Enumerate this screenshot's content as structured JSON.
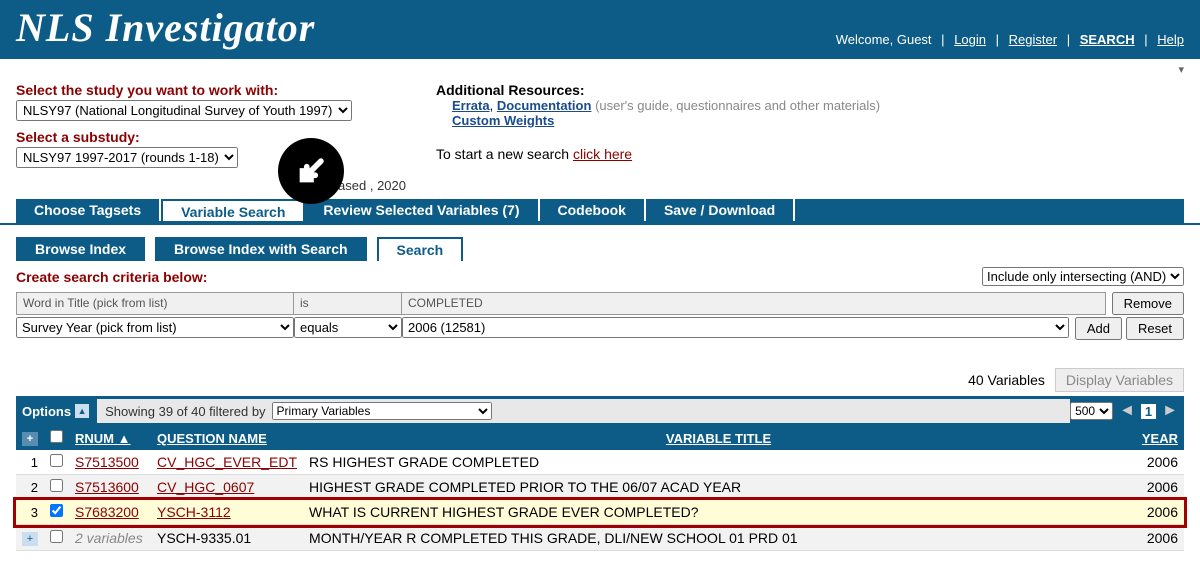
{
  "header": {
    "title": "NLS Investigator",
    "welcome": "Welcome, Guest",
    "links": {
      "login": "Login",
      "register": "Register",
      "search": "SEARCH",
      "help": "Help"
    }
  },
  "study": {
    "label": "Select the study you want to work with:",
    "value": "NLSY97 (National Longitudinal Survey of Youth 1997)",
    "substudy_label": "Select a substudy:",
    "substudy_value": "NLSY97 1997-2017 (rounds 1-18)",
    "released": "Released , 2020"
  },
  "resources": {
    "label": "Additional Resources:",
    "errata": "Errata",
    "documentation": "Documentation",
    "doc_hint": "(user's guide, questionnaires and other materials)",
    "custom_weights": "Custom Weights",
    "newsearch_prefix": "To start a new search ",
    "newsearch_link": "click here"
  },
  "tabs1": {
    "choose_tagsets": "Choose Tagsets",
    "variable_search": "Variable Search",
    "review": "Review Selected Variables (7)",
    "codebook": "Codebook",
    "save": "Save / Download"
  },
  "tabs2": {
    "browse_index": "Browse Index",
    "browse_search": "Browse Index with Search",
    "search": "Search"
  },
  "search": {
    "label": "Create search criteria below:",
    "mode": "Include only intersecting (AND)",
    "row1": {
      "field": "Word in Title   (pick from list)",
      "op": "is",
      "value": "COMPLETED",
      "btn": "Remove"
    },
    "row2": {
      "field": "Survey Year   (pick from list)",
      "op": "equals",
      "value": "2006 (12581)",
      "add": "Add",
      "reset": "Reset"
    }
  },
  "results": {
    "count": "40 Variables",
    "display_btn": "Display Variables",
    "options": "Options",
    "showing": "Showing 39 of 40  filtered by",
    "filter": "Primary Variables",
    "pagesize": "500",
    "page": "1",
    "headers": {
      "rnum": "RNUM",
      "qname": "QUESTION NAME",
      "vtitle": "VARIABLE TITLE",
      "year": "YEAR"
    },
    "rows": [
      {
        "idx": "1",
        "checked": false,
        "rnum": "S7513500",
        "qname": "CV_HGC_EVER_EDT",
        "title": "RS HIGHEST GRADE COMPLETED",
        "year": "2006",
        "rnum_link": true,
        "qname_link": true
      },
      {
        "idx": "2",
        "checked": false,
        "rnum": "S7513600",
        "qname": "CV_HGC_0607",
        "title": "HIGHEST GRADE COMPLETED PRIOR TO THE 06/07 ACAD YEAR",
        "year": "2006",
        "rnum_link": true,
        "qname_link": true
      },
      {
        "idx": "3",
        "checked": true,
        "rnum": "S7683200",
        "qname": "YSCH-3112",
        "title": "WHAT IS CURRENT HIGHEST GRADE EVER COMPLETED?",
        "year": "2006",
        "rnum_link": true,
        "qname_link": true,
        "selected": true
      },
      {
        "idx": "",
        "checked": false,
        "rnum": "2 variables",
        "qname": "YSCH-9335.01",
        "title": "MONTH/YEAR R COMPLETED THIS GRADE, DLI/NEW SCHOOL 01 PRD 01",
        "year": "2006",
        "rnum_link": false,
        "qname_link": false,
        "plus": true
      }
    ]
  }
}
